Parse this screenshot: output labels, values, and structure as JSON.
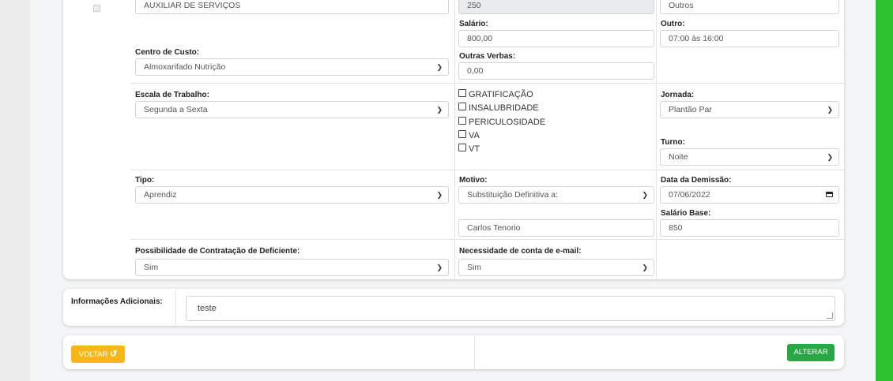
{
  "form": {
    "top_row": {
      "left_value": "AUXILIAR DE SERVIÇOS",
      "middle_value": "250",
      "right_value": "Outros"
    },
    "salario": {
      "label": "Salário:",
      "value": "800,00"
    },
    "outro": {
      "label": "Outro:",
      "value": "07:00 às 16:00"
    },
    "centro_custo": {
      "label": "Centro de Custo:",
      "value": "Almoxarifado Nutrição"
    },
    "outras_verbas": {
      "label": "Outras Verbas:",
      "value": "0,00"
    },
    "escala": {
      "label": "Escala de Trabalho:",
      "value": "Segunda a Sexta"
    },
    "beneficios": [
      "GRATIFICAÇÃO",
      "INSALUBRIDADE",
      "PERICULOSIDADE",
      "VA",
      "VT"
    ],
    "jornada": {
      "label": "Jornada:",
      "value": "Plantão Par"
    },
    "turno": {
      "label": "Turno:",
      "value": "Noite"
    },
    "tipo": {
      "label": "Tipo:",
      "value": "Aprendiz"
    },
    "motivo": {
      "label": "Motivo:",
      "value": "Substituição Definitiva a:",
      "substituto": "Carlos Tenorio"
    },
    "data_demissao": {
      "label": "Data da Demissão:",
      "value": "07/06/2022"
    },
    "salario_base": {
      "label": "Salário Base:",
      "value": "850"
    },
    "deficiente": {
      "label": "Possibilidade de Contratação de Deficiente:",
      "value": "Sim"
    },
    "conta_email": {
      "label": "Necessidade de conta de e-mail:",
      "value": "Sim"
    }
  },
  "info": {
    "label": "Informações Adicionais:",
    "value": "teste"
  },
  "actions": {
    "back_label": "VOLTAR",
    "back_icon": "undo-icon",
    "submit_label": "ALTERAR"
  },
  "colors": {
    "accent_green": "#2ec02e",
    "back_button": "#f7b718",
    "submit_button": "#27a845"
  }
}
